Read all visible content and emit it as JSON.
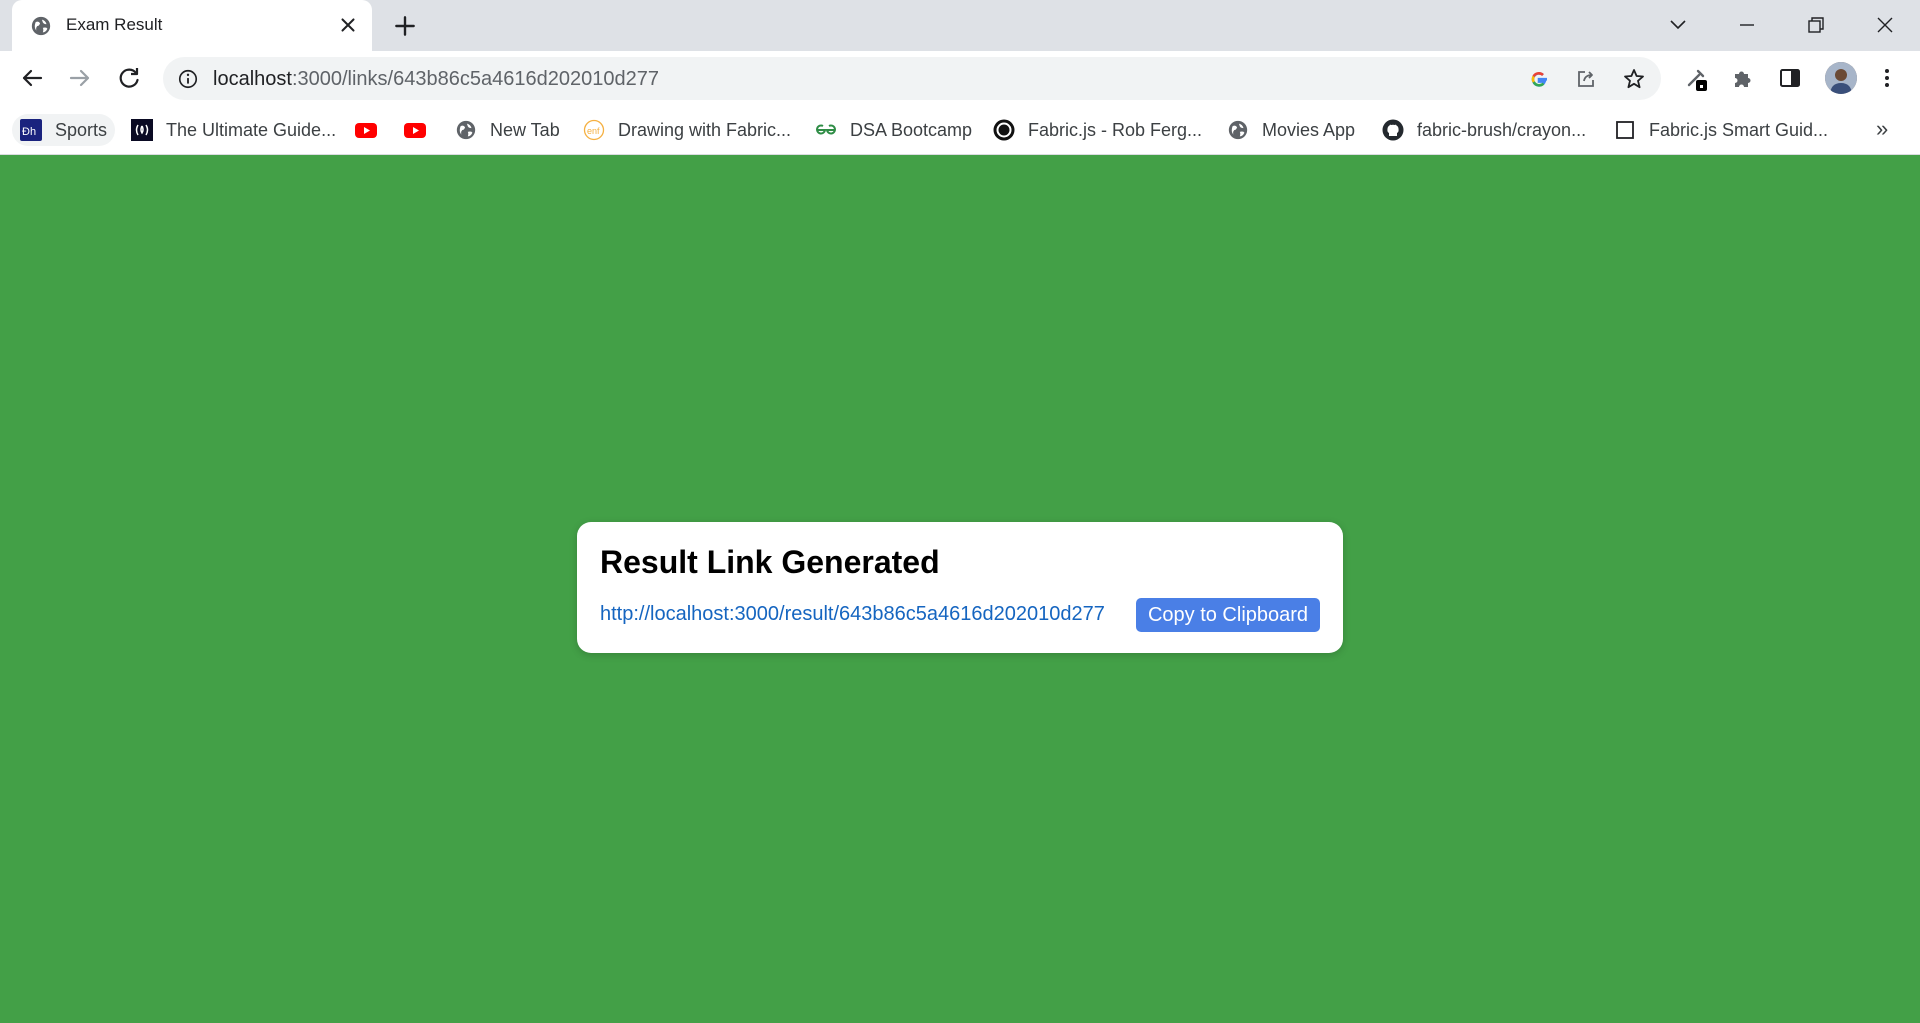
{
  "browser": {
    "tab": {
      "title": "Exam Result"
    },
    "url": {
      "host": "localhost",
      "rest": ":3000/links/643b86c5a4616d202010d277"
    },
    "bookmarks": [
      {
        "label": "Sports",
        "icon": "codingninjas-icon"
      },
      {
        "label": "The Ultimate Guide...",
        "icon": "freecodecamp-icon"
      },
      {
        "label": "",
        "icon": "youtube-icon"
      },
      {
        "label": "",
        "icon": "youtube-icon"
      },
      {
        "label": "New Tab",
        "icon": "globe-icon"
      },
      {
        "label": "Drawing with Fabric...",
        "icon": "enf-icon"
      },
      {
        "label": "DSA Bootcamp",
        "icon": "geeksforgeeks-icon"
      },
      {
        "label": "Fabric.js - Rob Ferg...",
        "icon": "circle-logo-icon"
      },
      {
        "label": "Movies App",
        "icon": "globe-icon"
      },
      {
        "label": "fabric-brush/crayon...",
        "icon": "github-icon"
      },
      {
        "label": "Fabric.js Smart Guid...",
        "icon": "page-icon"
      }
    ],
    "more_label": "»"
  },
  "page": {
    "background": "#43a047",
    "card": {
      "heading": "Result Link Generated",
      "link": "http://localhost:3000/result/643b86c5a4616d202010d277",
      "copy_button": "Copy to Clipboard"
    }
  }
}
